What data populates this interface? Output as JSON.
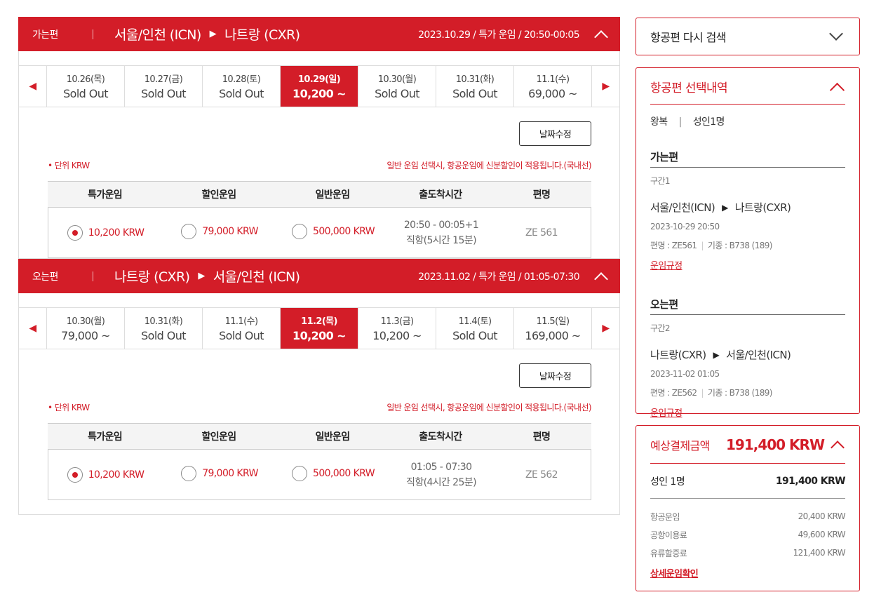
{
  "outbound": {
    "dir": "가는편",
    "from": "서울/인천 (ICN)",
    "to": "나트랑 (CXR)",
    "info": "2023.10.29 / 특가 운임 / 20:50-00:05",
    "dates": [
      {
        "d": "10.26(목)",
        "p": "Sold Out"
      },
      {
        "d": "10.27(금)",
        "p": "Sold Out"
      },
      {
        "d": "10.28(토)",
        "p": "Sold Out"
      },
      {
        "d": "10.29(일)",
        "p": "10,200 ~"
      },
      {
        "d": "10.30(월)",
        "p": "Sold Out"
      },
      {
        "d": "10.31(화)",
        "p": "Sold Out"
      },
      {
        "d": "11.1(수)",
        "p": "69,000 ~"
      }
    ],
    "modify": "날짜수정",
    "unit": "• 단위 KRW",
    "notice": "일반 운임 선택시, 항공운임에 신분할인이 적용됩니다.(국내선)",
    "headers": [
      "특가운임",
      "할인운임",
      "일반운임",
      "출도착시간",
      "편명"
    ],
    "fares": [
      "10,200 KRW",
      "79,000 KRW",
      "500,000 KRW"
    ],
    "time": "20:50 - 00:05+1",
    "duration": "직항(5시간 15분)",
    "flight": "ZE 561"
  },
  "inbound": {
    "dir": "오는편",
    "from": "나트랑 (CXR)",
    "to": "서울/인천 (ICN)",
    "info": "2023.11.02 / 특가 운임 / 01:05-07:30",
    "dates": [
      {
        "d": "10.30(월)",
        "p": "79,000 ~"
      },
      {
        "d": "10.31(화)",
        "p": "Sold Out"
      },
      {
        "d": "11.1(수)",
        "p": "Sold Out"
      },
      {
        "d": "11.2(목)",
        "p": "10,200 ~"
      },
      {
        "d": "11.3(금)",
        "p": "10,200 ~"
      },
      {
        "d": "11.4(토)",
        "p": "Sold Out"
      },
      {
        "d": "11.5(일)",
        "p": "169,000 ~"
      }
    ],
    "modify": "날짜수정",
    "unit": "• 단위 KRW",
    "notice": "일반 운임 선택시, 항공운임에 신분할인이 적용됩니다.(국내선)",
    "headers": [
      "특가운임",
      "할인운임",
      "일반운임",
      "출도착시간",
      "편명"
    ],
    "fares": [
      "10,200 KRW",
      "79,000 KRW",
      "500,000 KRW"
    ],
    "time": "01:05 - 07:30",
    "duration": "직항(4시간 25분)",
    "flight": "ZE 562"
  },
  "sidebar": {
    "research": "항공편 다시 검색",
    "selection": {
      "title": "항공편 선택내역",
      "trip_type": "왕복",
      "pax": "성인1명",
      "legs": [
        {
          "title": "가는편",
          "section": "구간1",
          "from": "서울/인천(ICN)",
          "to": "나트랑(CXR)",
          "datetime": "2023-10-29 20:50",
          "flight": "편명 : ZE561",
          "aircraft": "기종 : B738 (189)",
          "rule": "운임규정"
        },
        {
          "title": "오는편",
          "section": "구간2",
          "from": "나트랑(CXR)",
          "to": "서울/인천(ICN)",
          "datetime": "2023-11-02 01:05",
          "flight": "편명 : ZE562",
          "aircraft": "기종 : B738 (189)",
          "rule": "운임규정"
        }
      ]
    },
    "payment": {
      "title": "예상결제금액",
      "total": "191,400 KRW",
      "pax_label": "성인 1명",
      "pax_total": "191,400 KRW",
      "items": [
        {
          "label": "항공운임",
          "value": "20,400 KRW"
        },
        {
          "label": "공항이용료",
          "value": "49,600 KRW"
        },
        {
          "label": "유류할증료",
          "value": "121,400 KRW"
        }
      ],
      "detail_link": "상세운임확인"
    }
  },
  "colors": {
    "accent": "#d31d28"
  }
}
